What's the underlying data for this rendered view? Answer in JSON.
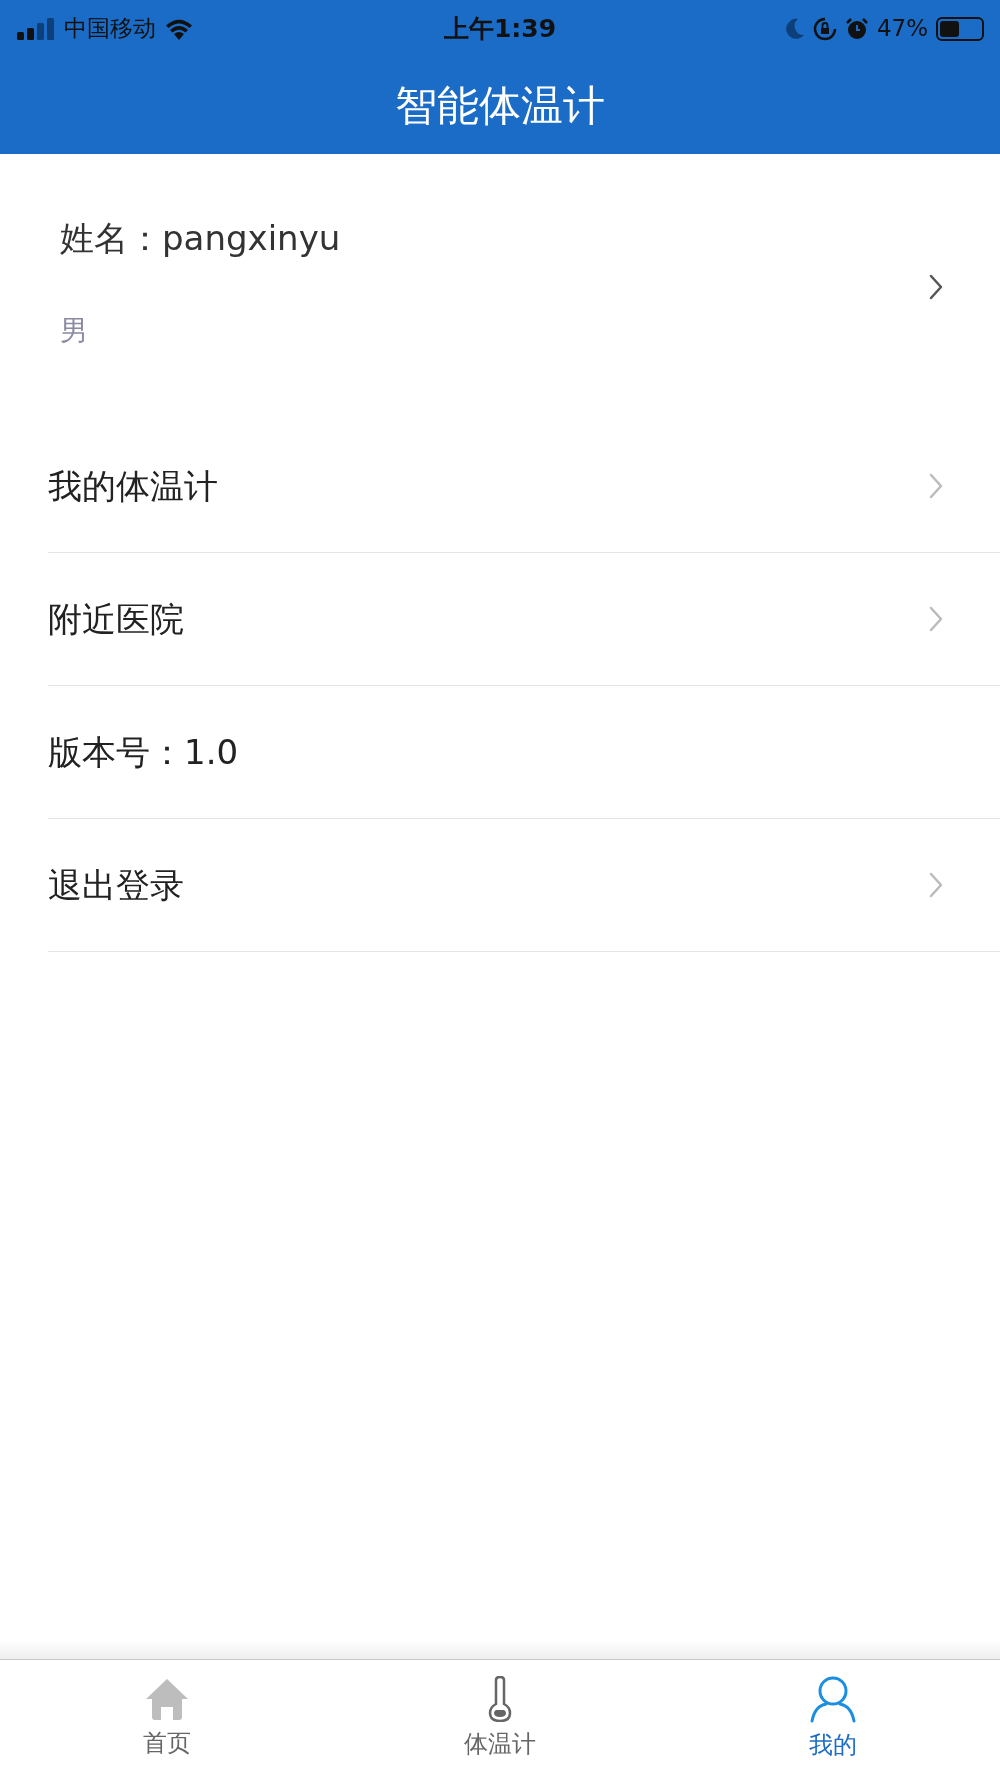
{
  "status_bar": {
    "carrier": "中国移动",
    "time": "上午1:39",
    "battery": "47%"
  },
  "header": {
    "title": "智能体温计"
  },
  "profile": {
    "name": "姓名：pangxinyu",
    "gender": "男"
  },
  "menu": [
    {
      "label": "我的体温计",
      "chevron": true
    },
    {
      "label": "附近医院",
      "chevron": true
    },
    {
      "label": "版本号：1.0",
      "chevron": false
    },
    {
      "label": "退出登录",
      "chevron": true
    }
  ],
  "tab_bar": [
    {
      "label": "首页",
      "selected": false
    },
    {
      "label": "体温计",
      "selected": false
    },
    {
      "label": "我的",
      "selected": true
    }
  ]
}
